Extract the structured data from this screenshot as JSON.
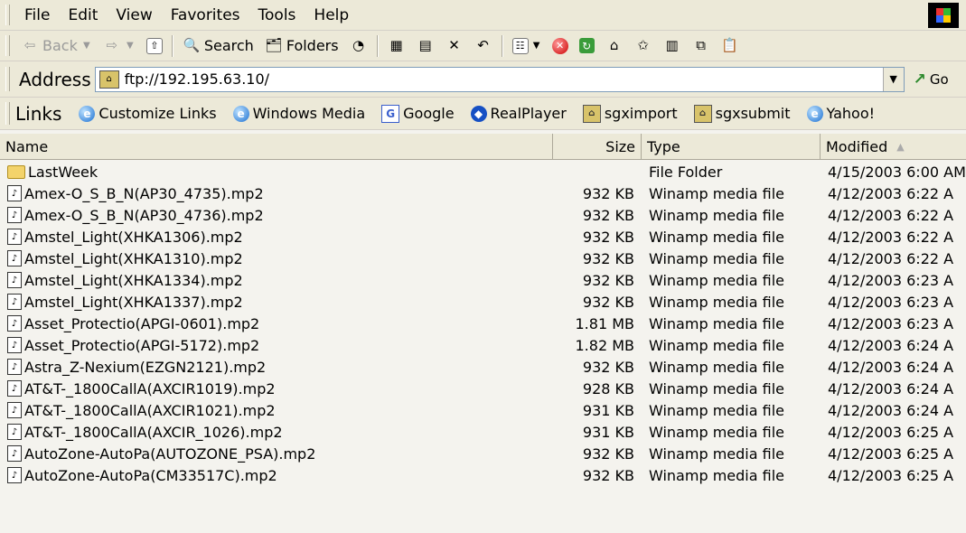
{
  "menu": [
    "File",
    "Edit",
    "View",
    "Favorites",
    "Tools",
    "Help"
  ],
  "toolbar": {
    "back": "Back",
    "search": "Search",
    "folders": "Folders"
  },
  "address": {
    "label": "Address",
    "value": "ftp://192.195.63.10/",
    "go": "Go"
  },
  "links": {
    "label": "Links",
    "items": [
      "Customize Links",
      "Windows Media",
      "Google",
      "RealPlayer",
      "sgximport",
      "sgxsubmit",
      "Yahoo!"
    ]
  },
  "columns": {
    "name": "Name",
    "size": "Size",
    "type": "Type",
    "modified": "Modified"
  },
  "files": [
    {
      "name": "LastWeek",
      "size": "",
      "type": "File Folder",
      "modified": "4/15/2003 6:00 AM",
      "kind": "folder"
    },
    {
      "name": "Amex-O_S_B_N(AP30_4735).mp2",
      "size": "932 KB",
      "type": "Winamp media file",
      "modified": "4/12/2003 6:22 A",
      "kind": "file"
    },
    {
      "name": "Amex-O_S_B_N(AP30_4736).mp2",
      "size": "932 KB",
      "type": "Winamp media file",
      "modified": "4/12/2003 6:22 A",
      "kind": "file"
    },
    {
      "name": "Amstel_Light(XHKA1306).mp2",
      "size": "932 KB",
      "type": "Winamp media file",
      "modified": "4/12/2003 6:22 A",
      "kind": "file"
    },
    {
      "name": "Amstel_Light(XHKA1310).mp2",
      "size": "932 KB",
      "type": "Winamp media file",
      "modified": "4/12/2003 6:22 A",
      "kind": "file"
    },
    {
      "name": "Amstel_Light(XHKA1334).mp2",
      "size": "932 KB",
      "type": "Winamp media file",
      "modified": "4/12/2003 6:23 A",
      "kind": "file"
    },
    {
      "name": "Amstel_Light(XHKA1337).mp2",
      "size": "932 KB",
      "type": "Winamp media file",
      "modified": "4/12/2003 6:23 A",
      "kind": "file"
    },
    {
      "name": "Asset_Protectio(APGI-0601).mp2",
      "size": "1.81 MB",
      "type": "Winamp media file",
      "modified": "4/12/2003 6:23 A",
      "kind": "file"
    },
    {
      "name": "Asset_Protectio(APGI-5172).mp2",
      "size": "1.82 MB",
      "type": "Winamp media file",
      "modified": "4/12/2003 6:24 A",
      "kind": "file"
    },
    {
      "name": "Astra_Z-Nexium(EZGN2121).mp2",
      "size": "932 KB",
      "type": "Winamp media file",
      "modified": "4/12/2003 6:24 A",
      "kind": "file"
    },
    {
      "name": "AT&T-_1800CallA(AXCIR1019).mp2",
      "size": "928 KB",
      "type": "Winamp media file",
      "modified": "4/12/2003 6:24 A",
      "kind": "file"
    },
    {
      "name": "AT&T-_1800CallA(AXCIR1021).mp2",
      "size": "931 KB",
      "type": "Winamp media file",
      "modified": "4/12/2003 6:24 A",
      "kind": "file"
    },
    {
      "name": "AT&T-_1800CallA(AXCIR_1026).mp2",
      "size": "931 KB",
      "type": "Winamp media file",
      "modified": "4/12/2003 6:25 A",
      "kind": "file"
    },
    {
      "name": "AutoZone-AutoPa(AUTOZONE_PSA).mp2",
      "size": "932 KB",
      "type": "Winamp media file",
      "modified": "4/12/2003 6:25 A",
      "kind": "file"
    },
    {
      "name": "AutoZone-AutoPa(CM33517C).mp2",
      "size": "932 KB",
      "type": "Winamp media file",
      "modified": "4/12/2003 6:25 A",
      "kind": "file"
    }
  ]
}
